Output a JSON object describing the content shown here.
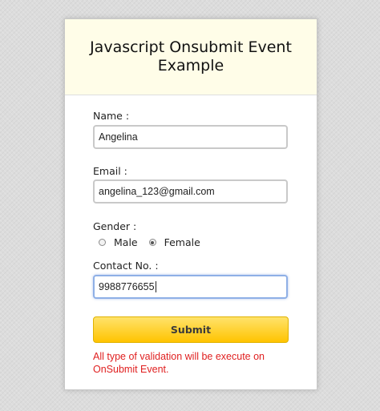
{
  "header": {
    "title": "Javascript Onsubmit Event Example"
  },
  "form": {
    "name": {
      "label": "Name :",
      "value": "Angelina"
    },
    "email": {
      "label": "Email :",
      "value": "angelina_123@gmail.com"
    },
    "gender": {
      "label": "Gender :",
      "options": [
        "Male",
        "Female"
      ],
      "selected": "Female"
    },
    "contact": {
      "label": "Contact No. :",
      "value": "9988776655"
    },
    "submit_label": "Submit",
    "note": "All type of validation will be execute on OnSubmit Event."
  },
  "colors": {
    "header_bg": "#fffde8",
    "button_top": "#ffe36b",
    "button_bottom": "#ffc400",
    "note_text": "#e02020",
    "focus_border": "#8fb0e6"
  }
}
